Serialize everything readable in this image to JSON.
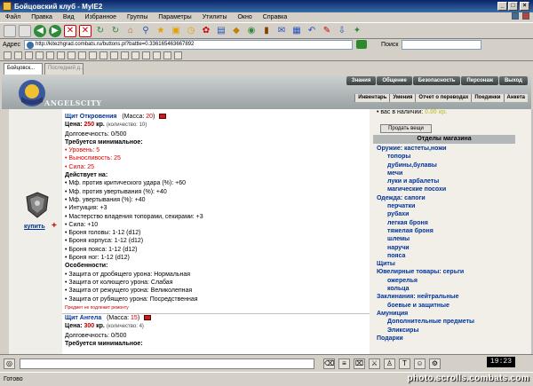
{
  "window": {
    "title": "Бойцовский клуб - MyIE2"
  },
  "menu": [
    "Файл",
    "Правка",
    "Вид",
    "Избранное",
    "Группы",
    "Параметры",
    "Утилиты",
    "Окно",
    "Справка"
  ],
  "address": {
    "label": "Адрес",
    "url": "http://kitezhgrad.combats.ru/buttons.pl?battle=0.336165463667892"
  },
  "search": {
    "label": "Поиск"
  },
  "tabs": [
    {
      "label": "Бойцовск..."
    },
    {
      "label": "Последний д..."
    }
  ],
  "game": {
    "city_label": "ANGELSCITY",
    "nav": [
      "Знания",
      "Общение",
      "Безопасность",
      "Персонаж",
      "Выход"
    ],
    "subnav": [
      "Инвентарь",
      "Умения",
      "Отчет о переводах",
      "Поединки",
      "Анкета"
    ]
  },
  "item1": {
    "name": "Щит Откровения",
    "mass_label": "(Масса:",
    "mass": "20",
    "mass_close": ")",
    "price_label": "Цена:",
    "price": "250",
    "price_unit": "кр.",
    "qty": "(количество: 10)",
    "durability": "Долговечность: 0/500",
    "req_title": "Требуется минимальное:",
    "requirements": [
      "• Уровень: 5",
      "• Выносливость: 25",
      "• Сила: 25"
    ],
    "acts_title": "Действует на:",
    "effects": [
      "• Мф. против критического удара (%): +60",
      "• Мф. против увертывания (%): +40",
      "• Мф. увертывания (%): +40",
      "• Интуиция: +3",
      "• Мастерство владения топорами, секирами: +3",
      "• Сила: +10",
      "• Броня головы: 1-12 (d12)",
      "• Броня корпуса: 1-12 (d12)",
      "• Броня пояса: 1-12 (d12)",
      "• Броня ног: 1-12 (d12)"
    ],
    "feat_title": "Особенности:",
    "features": [
      "• Защита от дробящего урона: Нормальная",
      "• Защита от колющего урона: Слабая",
      "• Защита от режущего урона: Великолепная",
      "• Защита от рубящего урона: Посредственная"
    ],
    "note": "Предмет не подлежит ремонту",
    "buy_label": "купить",
    "buy_plus": "+"
  },
  "item2": {
    "name": "Щит Ангела",
    "mass_label": "(Масса:",
    "mass": "15",
    "mass_close": ")",
    "price_label": "Цена:",
    "price": "300",
    "price_unit": "кр.",
    "qty": "(количество: 4)",
    "durability": "Долговечность: 0/500",
    "req_title": "Требуется минимальное:"
  },
  "sidebar": {
    "cut_prefix": "• вас в наличии:",
    "cut_amount": "0.00 кр.",
    "sell_button": "Продать вещи",
    "section_title": "Отделы магазина",
    "categories": [
      {
        "label": "Оружие: кастеты,ножи",
        "level": "cat"
      },
      {
        "label": "топоры",
        "level": "sub"
      },
      {
        "label": "дубины,булавы",
        "level": "sub"
      },
      {
        "label": "мечи",
        "level": "sub"
      },
      {
        "label": "луки и арбалеты",
        "level": "sub"
      },
      {
        "label": "магические посохи",
        "level": "sub"
      },
      {
        "label": "Одежда: сапоги",
        "level": "cat"
      },
      {
        "label": "перчатки",
        "level": "sub"
      },
      {
        "label": "рубахи",
        "level": "sub"
      },
      {
        "label": "легкая броня",
        "level": "sub"
      },
      {
        "label": "тяжелая броня",
        "level": "sub"
      },
      {
        "label": "шлемы",
        "level": "sub"
      },
      {
        "label": "наручи",
        "level": "sub"
      },
      {
        "label": "пояса",
        "level": "sub"
      },
      {
        "label": "Щиты",
        "level": "cat"
      },
      {
        "label": "Ювелирные товары: серьги",
        "level": "cat"
      },
      {
        "label": "ожерелья",
        "level": "sub"
      },
      {
        "label": "кольца",
        "level": "sub"
      },
      {
        "label": "Заклинания: нейтральные",
        "level": "cat"
      },
      {
        "label": "боевые и защитные",
        "level": "sub"
      },
      {
        "label": "Амуниция",
        "level": "cat"
      },
      {
        "label": "Дополнительные предметы",
        "level": "sub"
      },
      {
        "label": "Эликсиры",
        "level": "sub"
      },
      {
        "label": "Подарки",
        "level": "cat"
      }
    ]
  },
  "chat": {
    "clock": "19:23"
  },
  "status": {
    "text": "Готово",
    "watermark": "photo.scrolls.combats.com"
  }
}
